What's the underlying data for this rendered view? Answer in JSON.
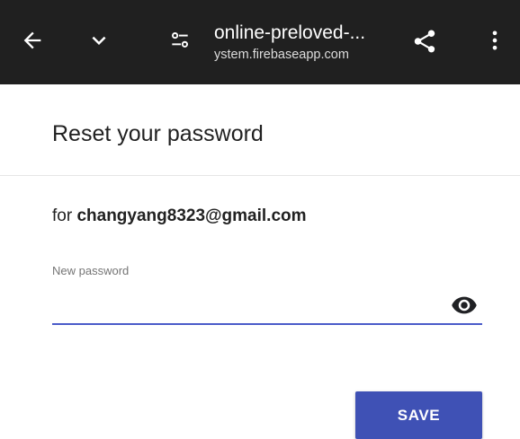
{
  "browser": {
    "page_title": "online-preloved-...",
    "domain": "ystem.firebaseapp.com",
    "icons": [
      "back-arrow-icon",
      "chevron-down-icon",
      "page-info-icon",
      "share-icon",
      "more-vert-icon"
    ]
  },
  "reset": {
    "title": "Reset your password",
    "for_prefix": "for ",
    "email": "changyang8323@gmail.com",
    "field_label": "New password",
    "field_value": "",
    "save_label": "SAVE"
  },
  "colors": {
    "topbar_bg": "#202020",
    "accent": "#3f51b5",
    "underline": "#4a5bc9"
  }
}
